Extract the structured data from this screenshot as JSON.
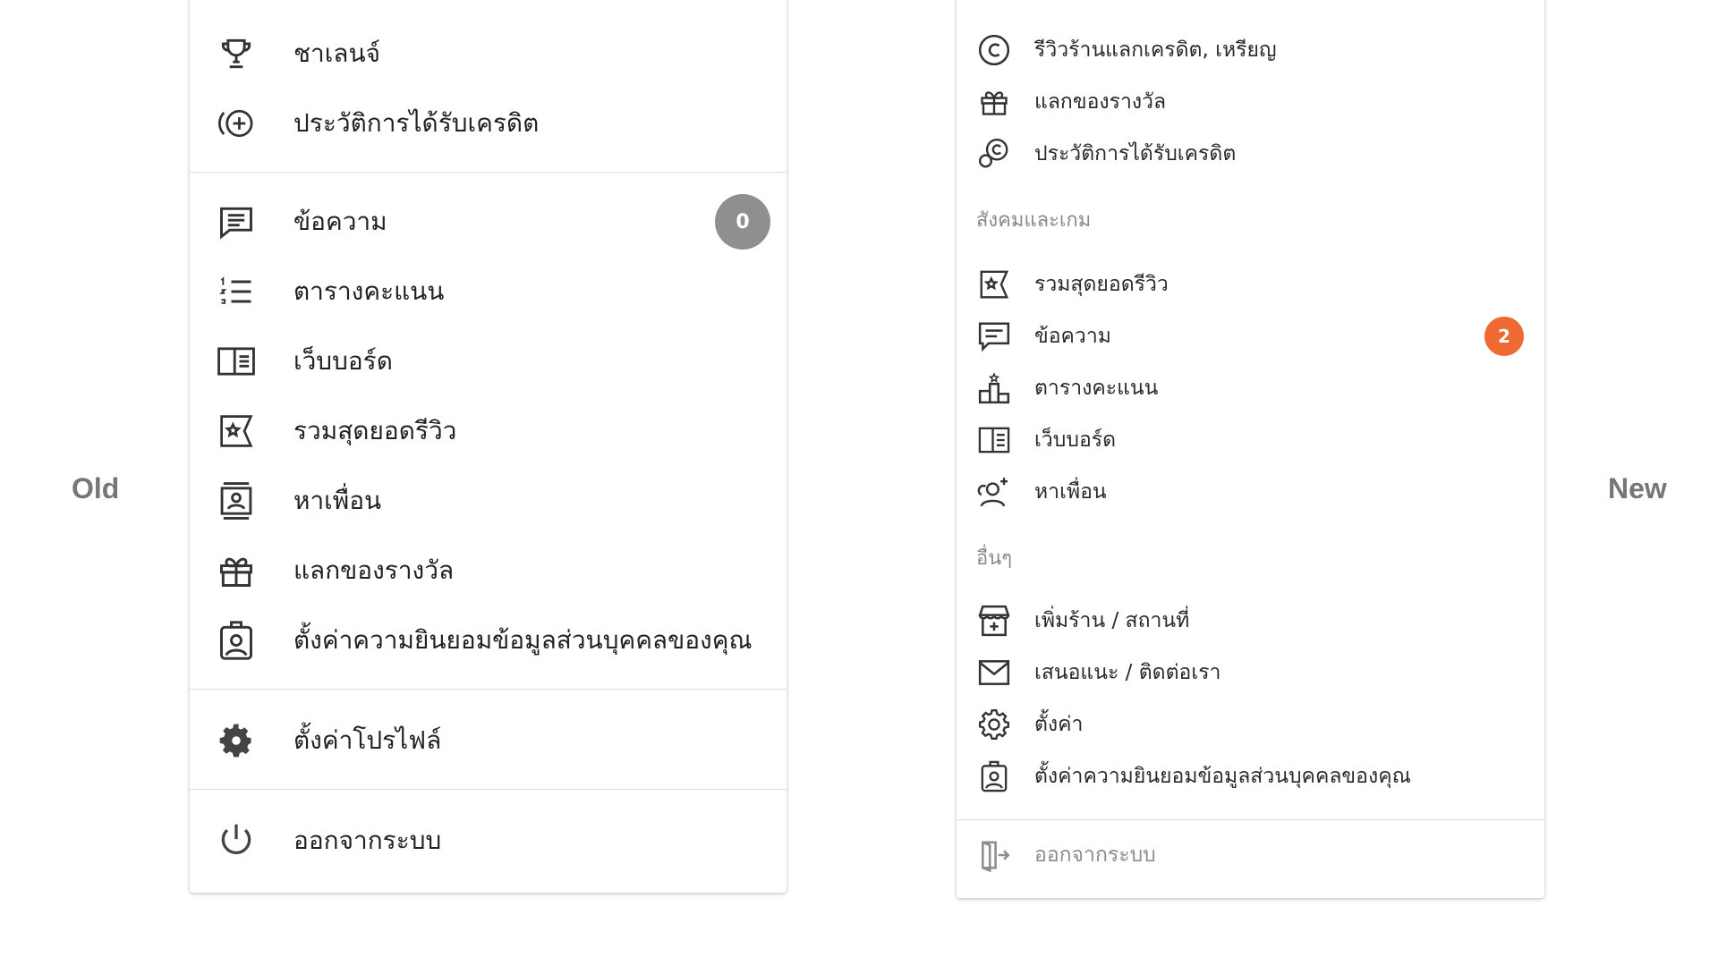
{
  "labels": {
    "old": "Old",
    "new": "New"
  },
  "old_menu": {
    "items": [
      {
        "label": "ชาเลนจ์"
      },
      {
        "label": "ประวัติการได้รับเครดิต"
      },
      {
        "label": "ข้อความ",
        "badge": "0"
      },
      {
        "label": "ตารางคะแนน"
      },
      {
        "label": "เว็บบอร์ด"
      },
      {
        "label": "รวมสุดยอดรีวิว"
      },
      {
        "label": "หาเพื่อน"
      },
      {
        "label": "แลกของรางวัล"
      },
      {
        "label": "ตั้งค่าความยินยอมข้อมูลส่วนบุคคลของคุณ"
      },
      {
        "label": "ตั้งค่าโปรไฟล์"
      },
      {
        "label": "ออกจากระบบ"
      }
    ],
    "badge_color": "#8f8f8f"
  },
  "new_menu": {
    "items_top": [
      {
        "label": "รีวิวร้านแลกเครดิต, เหรียญ"
      },
      {
        "label": "แลกของรางวัล"
      },
      {
        "label": "ประวัติการได้รับเครดิต"
      }
    ],
    "section_social": "สังคมและเกม",
    "items_social": [
      {
        "label": "รวมสุดยอดรีวิว"
      },
      {
        "label": "ข้อความ",
        "badge": "2"
      },
      {
        "label": "ตารางคะแนน"
      },
      {
        "label": "เว็บบอร์ด"
      },
      {
        "label": "หาเพื่อน"
      }
    ],
    "section_other": "อื่นๆ",
    "items_other": [
      {
        "label": "เพิ่มร้าน / สถานที่"
      },
      {
        "label": "เสนอแนะ / ติดต่อเรา"
      },
      {
        "label": "ตั้งค่า"
      },
      {
        "label": "ตั้งค่าความยินยอมข้อมูลส่วนบุคคลของคุณ"
      }
    ],
    "logout": "ออกจากระบบ",
    "badge_color": "#ee6a32"
  }
}
